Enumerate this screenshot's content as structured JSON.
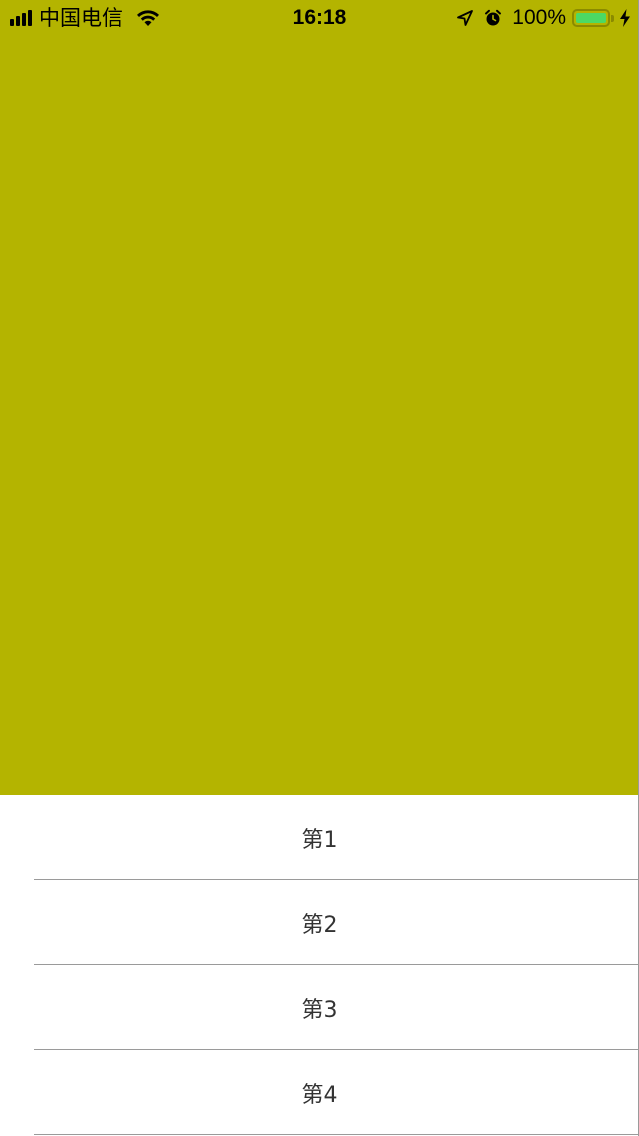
{
  "status_bar": {
    "carrier": "中国电信",
    "time": "16:18",
    "battery_percent": "100%",
    "icons": [
      "signal-icon",
      "wifi-icon",
      "location-arrow-icon",
      "alarm-icon",
      "battery-icon",
      "charging-bolt-icon"
    ]
  },
  "top_panel": {
    "background_color": "#b4b400"
  },
  "list": {
    "items": [
      {
        "label": "第1"
      },
      {
        "label": "第2"
      },
      {
        "label": "第3"
      },
      {
        "label": "第4"
      }
    ]
  },
  "colors": {
    "battery_fill": "#4cd964",
    "separator": "#9a9a9a",
    "row_text": "#333333"
  }
}
